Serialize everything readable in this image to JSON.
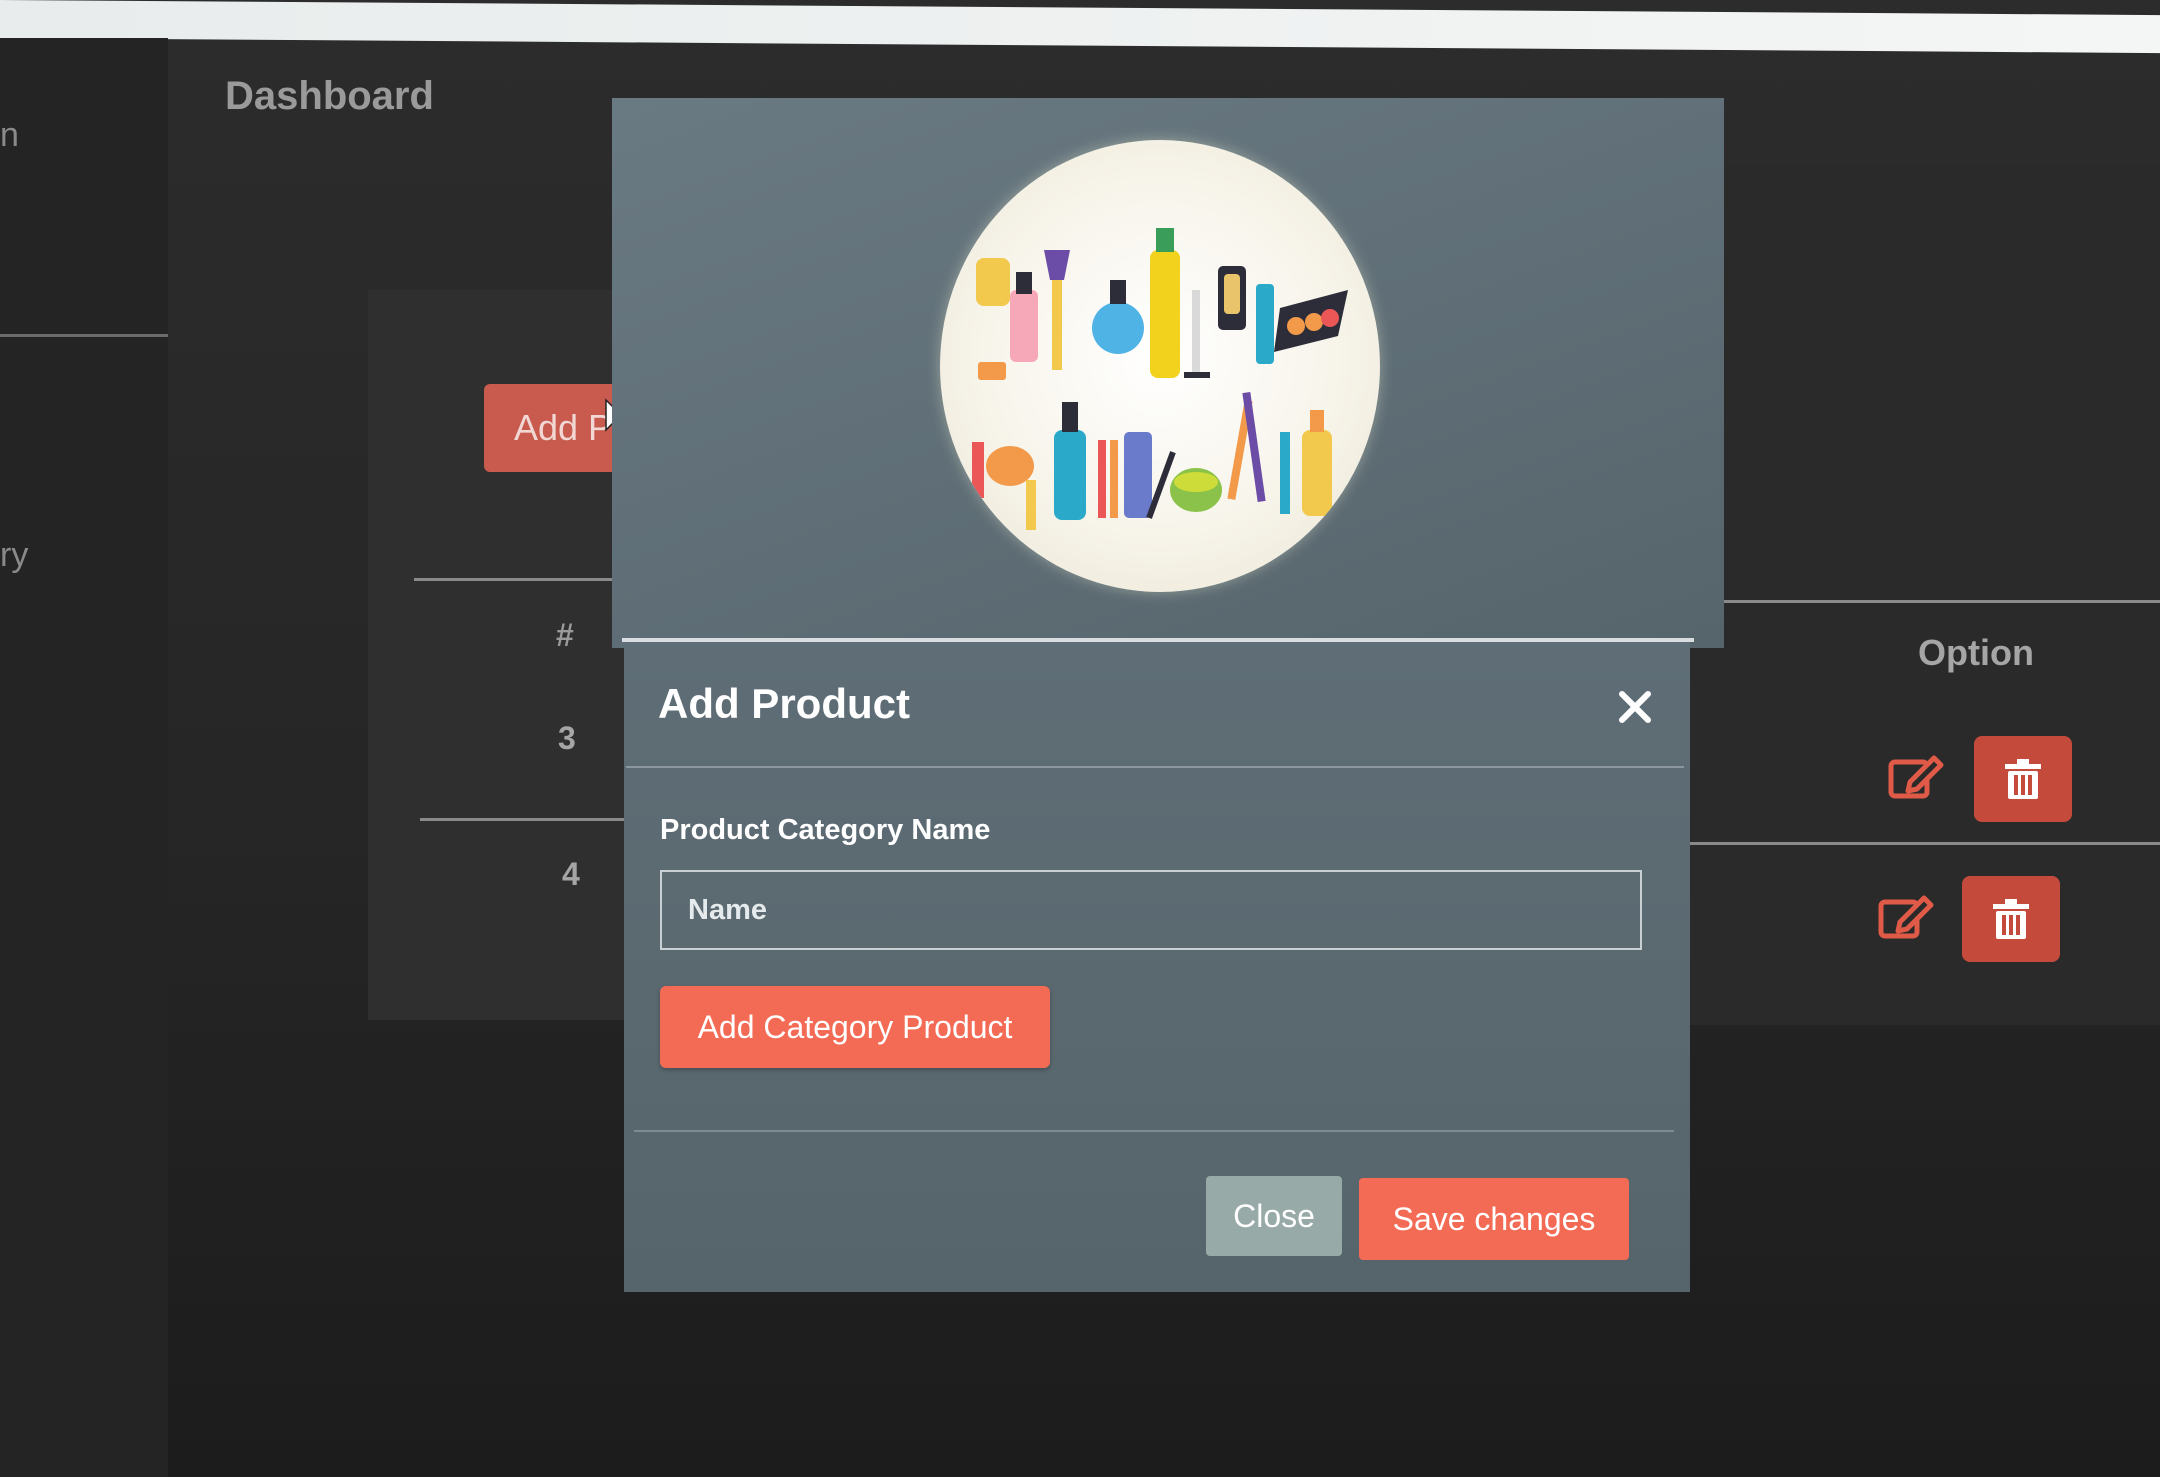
{
  "dashboard": {
    "title": "Dashboard",
    "sidebar_fragments": [
      "n",
      "ry"
    ],
    "add_button_label": "Add P"
  },
  "table": {
    "col_index_header": "#",
    "col_option_header": "Option",
    "rows": [
      {
        "index": "3"
      },
      {
        "index": "4"
      }
    ]
  },
  "modal": {
    "title": "Add Product",
    "field_label": "Product Category Name",
    "input_placeholder": "Name",
    "input_value": "",
    "add_category_label": "Add Category Product",
    "close_label": "Close",
    "save_label": "Save changes"
  },
  "icons": {
    "edit": "edit-icon",
    "delete": "trash-icon",
    "close": "close-icon",
    "cursor": "mouse-pointer-icon"
  },
  "colors": {
    "accent": "#f36b55",
    "danger": "#c44a3b",
    "modal_bg": "#5f6e76"
  }
}
